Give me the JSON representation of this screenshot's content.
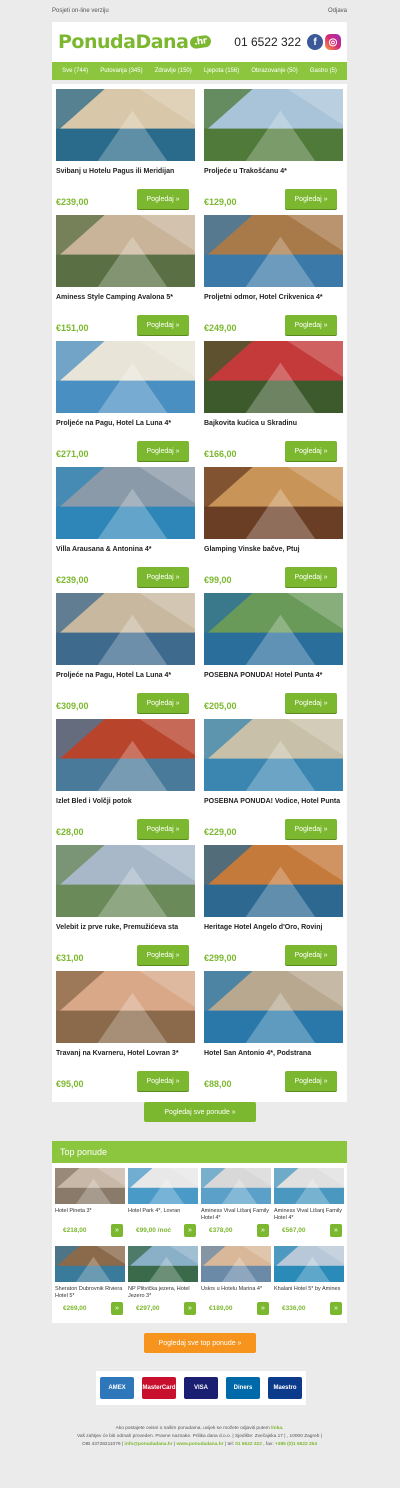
{
  "topbar": {
    "online": "Posjeti on-line verziju",
    "logout": "Odjava"
  },
  "header": {
    "logo": "PonudaDana",
    "logo_tld": ".hr",
    "phone": "01 6522 322",
    "facebook": "f",
    "instagram": "◎"
  },
  "nav": [
    {
      "label": "Sve (744)"
    },
    {
      "label": "Putovanja (345)"
    },
    {
      "label": "Zdravlje (150)"
    },
    {
      "label": "Ljepota (156)"
    },
    {
      "label": "Obrazovanje (50)"
    },
    {
      "label": "Gastro (5)"
    }
  ],
  "button_label": "Pogledaj »",
  "offers": [
    {
      "title": "Svibanj u Hotelu Pagus ili Meridijan",
      "price": "€239,00",
      "c1": "#2a6a8a",
      "c2": "#d8c7a8"
    },
    {
      "title": "Proljeće u Trakošćanu 4*",
      "price": "€129,00",
      "c1": "#4f7a3a",
      "c2": "#a9c4d8"
    },
    {
      "title": "Aminess Style Camping Avalona 5*",
      "price": "€151,00",
      "c1": "#5a7044",
      "c2": "#c9b49a"
    },
    {
      "title": "Proljetni odmor, Hotel Crikvenica 4*",
      "price": "€249,00",
      "c1": "#3b7aa8",
      "c2": "#a87a4a"
    },
    {
      "title": "Proljeće na Pagu, Hotel La Luna 4*",
      "price": "€271,00",
      "c1": "#4a8fc2",
      "c2": "#e8e4d8"
    },
    {
      "title": "Bajkovita kućica u Skradinu",
      "price": "€166,00",
      "c1": "#3c5a2c",
      "c2": "#c43a3a"
    },
    {
      "title": "Villa Arausana & Antonina 4*",
      "price": "€239,00",
      "c1": "#2e86b8",
      "c2": "#8a9aa8"
    },
    {
      "title": "Glamping Vinske bačve, Ptuj",
      "price": "€99,00",
      "c1": "#6a3e24",
      "c2": "#c89458"
    },
    {
      "title": "Proljeće na Pagu, Hotel La Luna 4*",
      "price": "€309,00",
      "c1": "#3e6a8e",
      "c2": "#c8b8a0"
    },
    {
      "title": "POSEBNA PONUDA! Hotel Punta 4*",
      "price": "€205,00",
      "c1": "#2a6e9c",
      "c2": "#6a9a5a"
    },
    {
      "title": "Izlet Bled i Volčji potok",
      "price": "€28,00",
      "c1": "#4a7a9a",
      "c2": "#b8442c"
    },
    {
      "title": "POSEBNA PONUDA! Vodice, Hotel Punta",
      "price": "€229,00",
      "c1": "#3a86b0",
      "c2": "#c8c0a8"
    },
    {
      "title": "Velebit iz prve ruke, Premužićeva sta",
      "price": "€31,00",
      "c1": "#6a8a5a",
      "c2": "#a8b8c8"
    },
    {
      "title": "Heritage Hotel Angelo d'Oro, Rovinj",
      "price": "€299,00",
      "c1": "#2c6890",
      "c2": "#c47a3a"
    },
    {
      "title": "Travanj na Kvarneru, Hotel Lovran 3*",
      "price": "€95,00",
      "c1": "#8a6a4a",
      "c2": "#d8a888"
    },
    {
      "title": "Hotel San Antonio 4*, Podstrana",
      "price": "€88,00",
      "c1": "#2a78aa",
      "c2": "#b8a890"
    }
  ],
  "all_offers_button": "Pogledaj sve ponude »",
  "top_offers": {
    "heading": "Top ponude",
    "button": "Pogledaj sve top ponude »",
    "arrow": "»",
    "items": [
      {
        "title": "Hotel Pineta 3*",
        "price": "€218,00",
        "c1": "#8a7a6a",
        "c2": "#c8b8a8"
      },
      {
        "title": "Hotel Park 4*, Lovran",
        "price": "€99,00 /noć",
        "c1": "#4a9ac8",
        "c2": "#e8e8e8"
      },
      {
        "title": "Aminess Vival Lišanj Family Hotel 4*",
        "price": "€378,00",
        "c1": "#5aa0c8",
        "c2": "#d8d8d8"
      },
      {
        "title": "Aminess Vival Lišanj Family Hotel 4*",
        "price": "€567,00",
        "c1": "#4a98c0",
        "c2": "#e0e0e0"
      },
      {
        "title": "Sheraton Dubrovnik Riviera Hotel 5*",
        "price": "€269,00",
        "c1": "#3a7a9a",
        "c2": "#8a6a4a"
      },
      {
        "title": "NP Plitvička jezera, Hotel Jezero 3*",
        "price": "€297,00",
        "c1": "#3a6a4a",
        "c2": "#8ab0c8"
      },
      {
        "title": "Uskrs u Hotelu Marina 4*",
        "price": "€189,00",
        "c1": "#6a8aa8",
        "c2": "#d8b898"
      },
      {
        "title": "Khalani Hotel 5* by Amines",
        "price": "€336,00",
        "c1": "#2a8ab8",
        "c2": "#b8c8d8"
      }
    ]
  },
  "payments": [
    {
      "name": "AMEX",
      "color": "#2e77bb"
    },
    {
      "name": "MasterCard",
      "color": "#c8102e"
    },
    {
      "name": "VISA",
      "color": "#1a1f71"
    },
    {
      "name": "Diners",
      "color": "#0069aa"
    },
    {
      "name": "Maestro",
      "color": "#0d3b8c"
    }
  ],
  "footer": {
    "line1": "Ako postajete ovisni o našim ponudama, uvijek se možete odjaviti putem",
    "line1_link": "linka.",
    "line2": "Vaš zahtjev će biti odmah proveden. Pravne naznake. Prilika dana d.o.o. | Sjedište: Zvečajska 17 | , 10000 Zagreb |",
    "line3_a": "OIB 43728211079 |",
    "email": "info@ponudadana.hr",
    "sep": "|",
    "web": "www.ponudadana.hr",
    "line3_b": "| tel:",
    "tel": "01 6522 322",
    "line3_c": ", fax:",
    "fax": "+385 (0)1 6522 264"
  }
}
